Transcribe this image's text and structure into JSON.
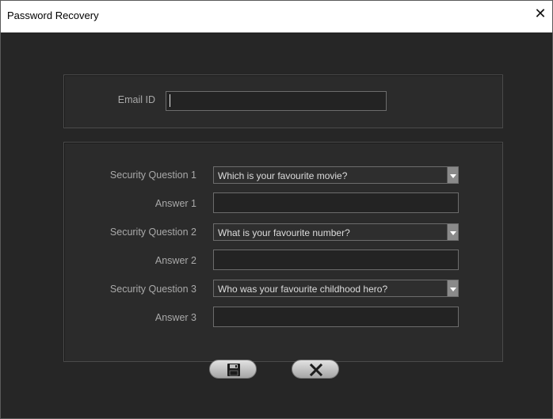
{
  "window": {
    "title": "Password Recovery",
    "close_glyph": "✕"
  },
  "email": {
    "label": "Email ID",
    "value": ""
  },
  "security": {
    "questions": [
      {
        "label": "Security Question 1",
        "selected": "Which is your favourite movie?",
        "answer_label": "Answer 1",
        "answer_value": ""
      },
      {
        "label": "Security Question 2",
        "selected": "What is your favourite number?",
        "answer_label": "Answer 2",
        "answer_value": ""
      },
      {
        "label": "Security Question 3",
        "selected": "Who was your favourite childhood hero?",
        "answer_label": "Answer 3",
        "answer_value": ""
      }
    ]
  },
  "buttons": {
    "save_icon": "floppy-disk-icon",
    "cancel_icon": "close-x-icon"
  },
  "colors": {
    "background": "#262626",
    "panel": "#2b2b2b",
    "label": "#a9a9a9",
    "button": "#c8c8c8"
  }
}
